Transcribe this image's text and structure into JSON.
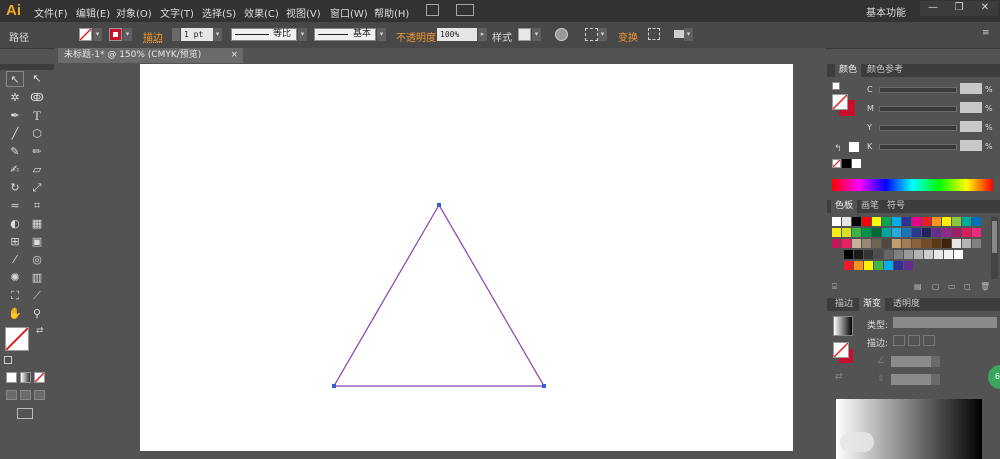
{
  "app": {
    "logo": "Ai",
    "workspace": "基本功能"
  },
  "menu": [
    "文件(F)",
    "编辑(E)",
    "对象(O)",
    "文字(T)",
    "选择(S)",
    "效果(C)",
    "视图(V)",
    "窗口(W)",
    "帮助(H)"
  ],
  "window_controls": {
    "minimize": "—",
    "restore": "❐",
    "close": "✕"
  },
  "control_bar": {
    "selection_label": "路径",
    "stroke_label": "描边",
    "stroke_weight": "1 pt",
    "variable_width": "等比",
    "brush": "基本",
    "opacity_label": "不透明度",
    "opacity_value": "100%",
    "style_label": "样式",
    "transform_label": "变换"
  },
  "document": {
    "tab_title": "未标题-1* @ 150% (CMYK/预览)",
    "close": "×"
  },
  "canvas": {
    "stroke_color": "#8a3fb0",
    "anchor_color": "#2f5fd0"
  },
  "color_panel": {
    "tabs": [
      "颜色",
      "颜色参考"
    ],
    "channels": [
      "C",
      "M",
      "Y",
      "K"
    ],
    "percent": "%"
  },
  "swatches_panel": {
    "tabs": [
      "色板",
      "画笔",
      "符号"
    ]
  },
  "gradient_panel": {
    "tabs": [
      "描边",
      "渐变",
      "透明度"
    ],
    "type_label": "类型:",
    "stroke_label": "描边:"
  },
  "badge": {
    "text": "67"
  },
  "colors": {
    "accent_orange": "#f39a2e",
    "app_bg": "#535353",
    "menubar_bg": "#323232",
    "canvas_bg": "#ffffff"
  }
}
